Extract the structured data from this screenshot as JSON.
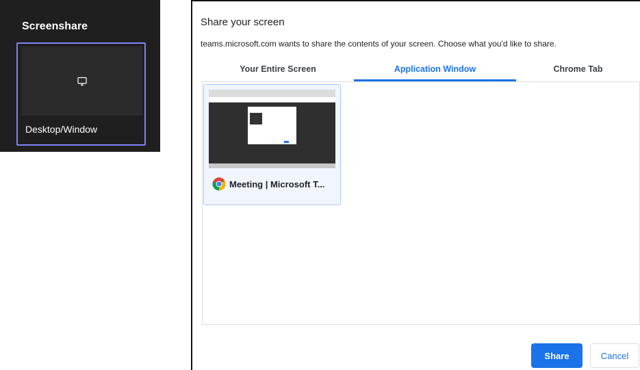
{
  "teams": {
    "title": "Screenshare",
    "tile_label": "Desktop/Window",
    "tile_icon": "monitor-icon"
  },
  "dialog": {
    "title": "Share your screen",
    "subtitle": "teams.microsoft.com wants to share the contents of your screen. Choose what you'd like to share.",
    "tabs": [
      {
        "label": "Your Entire Screen",
        "active": false
      },
      {
        "label": "Application Window",
        "active": true
      },
      {
        "label": "Chrome Tab",
        "active": false
      }
    ],
    "windows": [
      {
        "label": "Meeting | Microsoft T...",
        "icon": "chrome-icon"
      }
    ],
    "share_label": "Share",
    "cancel_label": "Cancel"
  },
  "colors": {
    "accent": "#1a73e8",
    "teams_bg": "#1f1f1f",
    "teams_highlight": "#7f85f5"
  }
}
